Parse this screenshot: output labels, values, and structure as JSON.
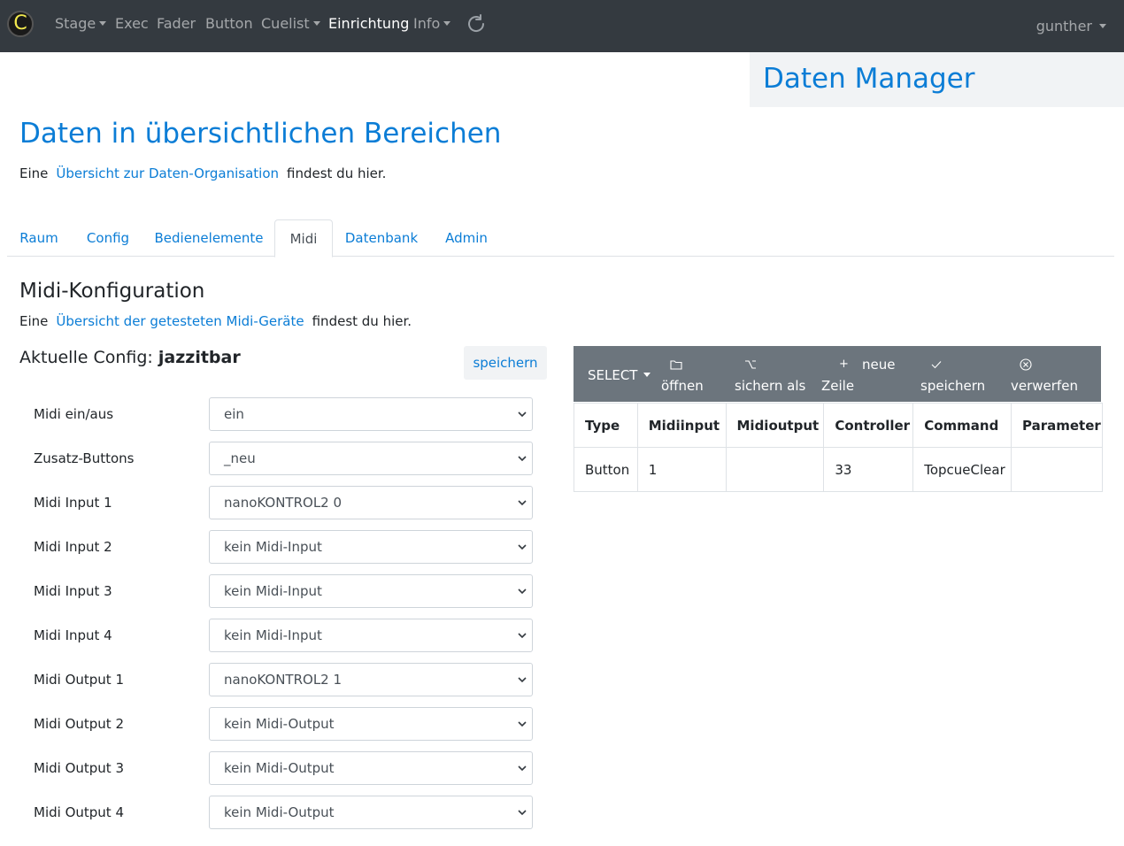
{
  "nav": {
    "brand": "C",
    "items": [
      {
        "label": "Stage",
        "dropdown": true
      },
      {
        "label": "Exec",
        "dropdown": false
      },
      {
        "label": "Fader",
        "dropdown": false
      },
      {
        "label": "Button",
        "dropdown": false
      },
      {
        "label": "Cuelist",
        "dropdown": true
      },
      {
        "label": "Einrichtung",
        "dropdown": false,
        "active": true
      },
      {
        "label": "Info",
        "dropdown": true
      }
    ],
    "refresh_icon": "refresh-icon",
    "user": "gunther"
  },
  "header": {
    "title": "Daten Manager"
  },
  "main": {
    "heading": "Daten in übersichtlichen Bereichen",
    "intro_prefix": "Eine",
    "intro_link": "Übersicht zur Daten-Organisation",
    "intro_suffix": "findest du hier."
  },
  "tabs": [
    {
      "label": "Raum"
    },
    {
      "label": "Config"
    },
    {
      "label": "Bedienelemente"
    },
    {
      "label": "Midi",
      "active": true
    },
    {
      "label": "Datenbank"
    },
    {
      "label": "Admin"
    }
  ],
  "midi": {
    "heading": "Midi-Konfiguration",
    "intro_prefix": "Eine",
    "intro_link": "Übersicht der getesteten Midi-Geräte",
    "intro_suffix": "findest du hier.",
    "config_label": "Aktuelle Config:",
    "config_name": "jazzitbar",
    "save_label": "speichern",
    "rows": [
      {
        "label": "Midi ein/aus",
        "value": "ein"
      },
      {
        "label": "Zusatz-Buttons",
        "value": "_neu"
      },
      {
        "label": "Midi Input 1",
        "value": "nanoKONTROL2 0"
      },
      {
        "label": "Midi Input 2",
        "value": "kein Midi-Input"
      },
      {
        "label": "Midi Input 3",
        "value": "kein Midi-Input"
      },
      {
        "label": "Midi Input 4",
        "value": "kein Midi-Input"
      },
      {
        "label": "Midi Output 1",
        "value": "nanoKONTROL2 1"
      },
      {
        "label": "Midi Output 2",
        "value": "kein Midi-Output"
      },
      {
        "label": "Midi Output 3",
        "value": "kein Midi-Output"
      },
      {
        "label": "Midi Output 4",
        "value": "kein Midi-Output"
      }
    ]
  },
  "toolbar": {
    "select_label": "SELECT",
    "open_label": "öffnen",
    "open_icon": "folder-icon",
    "save_as_label": "sichern als",
    "save_as_icon": "option-icon",
    "new_row_label_1": "neue",
    "new_row_label_2": "Zeile",
    "new_row_icon": "plus-icon",
    "save_label": "speichern",
    "save_icon": "check-icon",
    "discard_label": "verwerfen",
    "discard_icon": "close-circle-icon"
  },
  "table": {
    "columns": [
      "Type",
      "Midiinput",
      "Midioutput",
      "Controller",
      "Command",
      "Parameter"
    ],
    "rows": [
      [
        "Button",
        "1",
        "",
        "33",
        "TopcueClear",
        ""
      ]
    ]
  }
}
